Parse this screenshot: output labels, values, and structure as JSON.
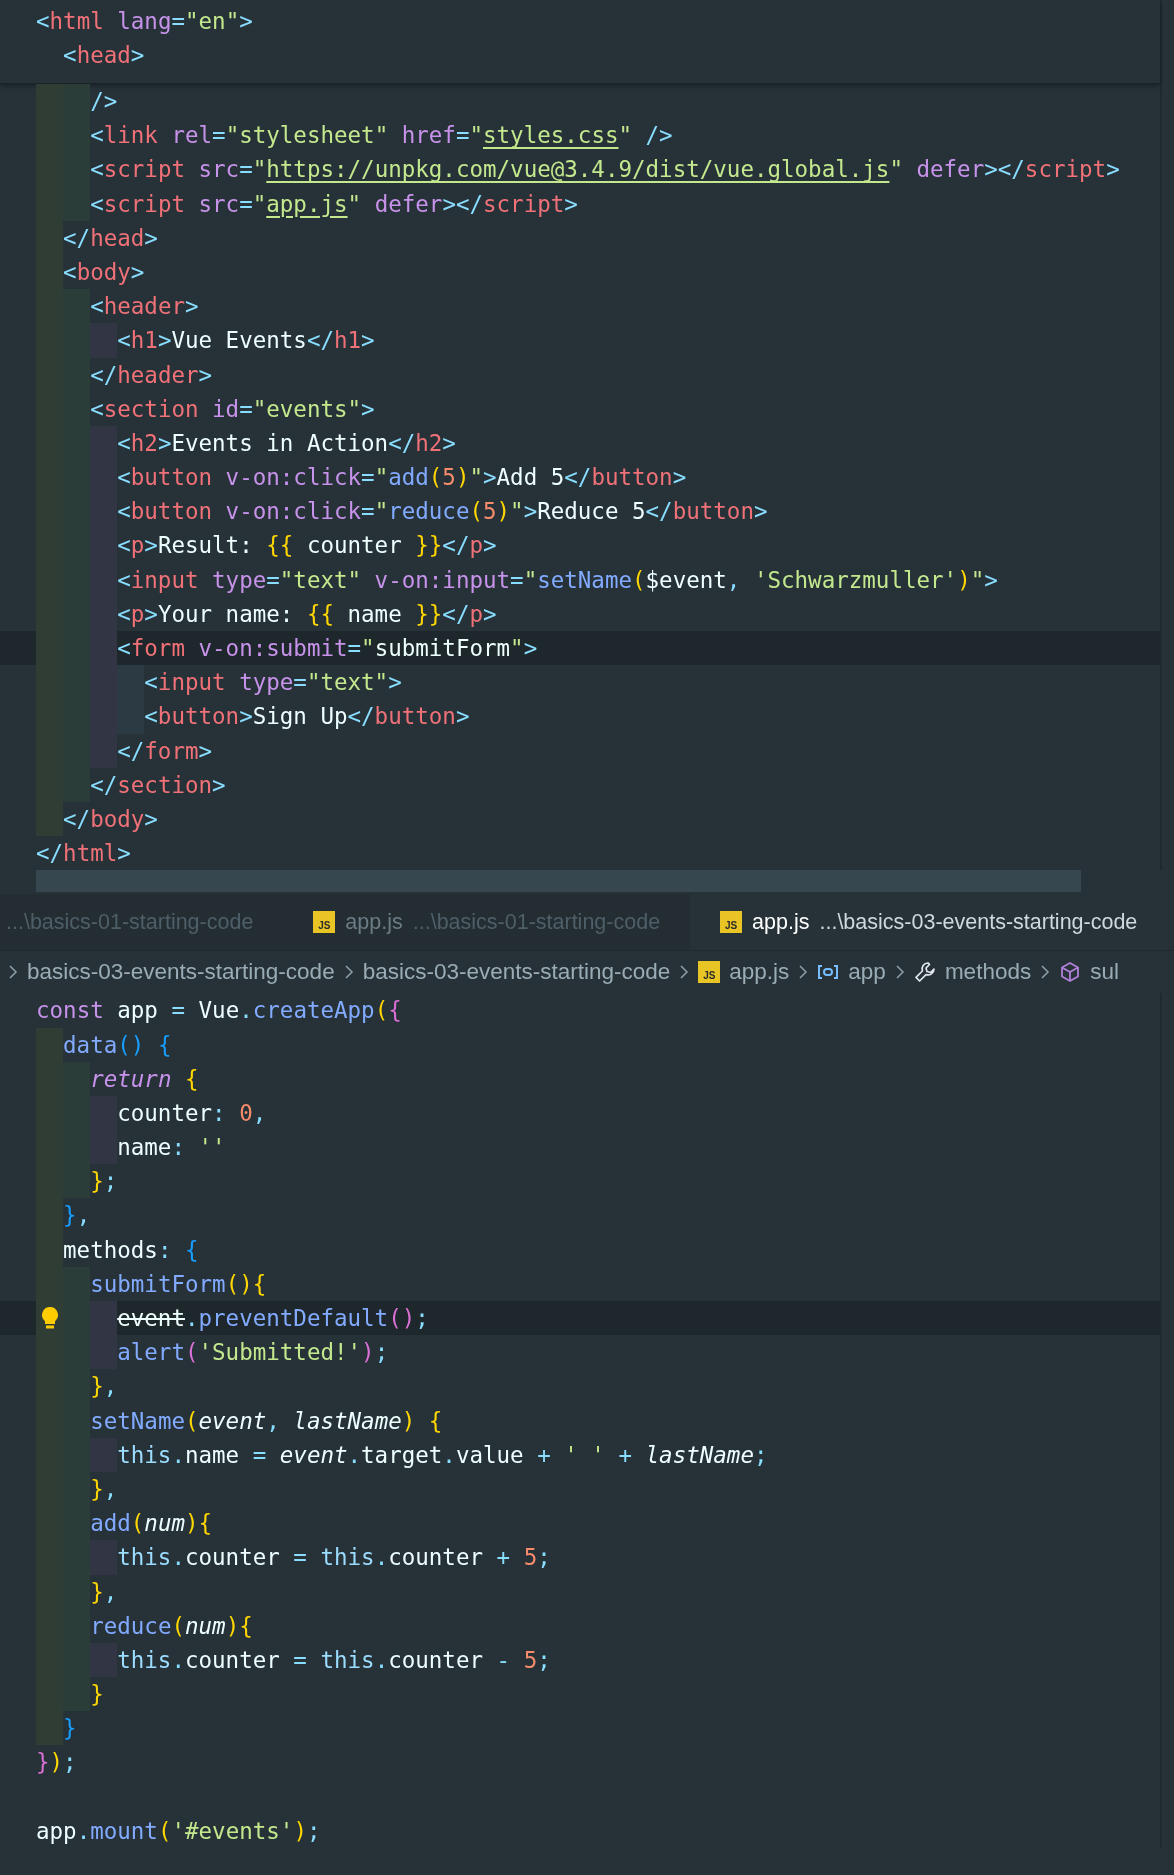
{
  "top_editor": {
    "sticky_lines": [
      {
        "tokens": [
          {
            "text": "<",
            "kind": "punct"
          },
          {
            "text": "html",
            "kind": "tag"
          },
          {
            "text": " lang",
            "kind": "attr"
          },
          {
            "text": "=",
            "kind": "punct"
          },
          {
            "text": "\"en\"",
            "kind": "string"
          },
          {
            "text": ">",
            "kind": "punct"
          }
        ]
      },
      {
        "tokens": [
          {
            "text": "  <",
            "kind": "punct"
          },
          {
            "text": "head",
            "kind": "tag"
          },
          {
            "text": ">",
            "kind": "punct"
          }
        ]
      }
    ],
    "lines": [
      {
        "current": false,
        "lightbulb": false,
        "tokens": [
          {
            "text": "    />",
            "kind": "punct"
          }
        ]
      },
      {
        "current": false,
        "lightbulb": false,
        "tokens": [
          {
            "text": "    <",
            "kind": "punct"
          },
          {
            "text": "link",
            "kind": "tag"
          },
          {
            "text": " rel",
            "kind": "attr"
          },
          {
            "text": "=",
            "kind": "punct"
          },
          {
            "text": "\"stylesheet\"",
            "kind": "string"
          },
          {
            "text": " href",
            "kind": "attr"
          },
          {
            "text": "=",
            "kind": "punct"
          },
          {
            "text": "\"",
            "kind": "string"
          },
          {
            "text": "styles.css",
            "kind": "link"
          },
          {
            "text": "\"",
            "kind": "string"
          },
          {
            "text": " />",
            "kind": "punct"
          }
        ]
      },
      {
        "current": false,
        "lightbulb": false,
        "tokens": [
          {
            "text": "    <",
            "kind": "punct"
          },
          {
            "text": "script",
            "kind": "tag"
          },
          {
            "text": " src",
            "kind": "attr"
          },
          {
            "text": "=",
            "kind": "punct"
          },
          {
            "text": "\"",
            "kind": "string"
          },
          {
            "text": "https://unpkg.com/vue@3.4.9/dist/vue.global.js",
            "kind": "link"
          },
          {
            "text": "\"",
            "kind": "string"
          },
          {
            "text": " defer",
            "kind": "attr"
          },
          {
            "text": "></",
            "kind": "punct"
          },
          {
            "text": "script",
            "kind": "tag"
          },
          {
            "text": ">",
            "kind": "punct"
          }
        ]
      },
      {
        "current": false,
        "lightbulb": false,
        "tokens": [
          {
            "text": "    <",
            "kind": "punct"
          },
          {
            "text": "script",
            "kind": "tag"
          },
          {
            "text": " src",
            "kind": "attr"
          },
          {
            "text": "=",
            "kind": "punct"
          },
          {
            "text": "\"",
            "kind": "string"
          },
          {
            "text": "app.js",
            "kind": "link"
          },
          {
            "text": "\"",
            "kind": "string"
          },
          {
            "text": " defer",
            "kind": "attr"
          },
          {
            "text": "></",
            "kind": "punct"
          },
          {
            "text": "script",
            "kind": "tag"
          },
          {
            "text": ">",
            "kind": "punct"
          }
        ]
      },
      {
        "current": false,
        "lightbulb": false,
        "tokens": [
          {
            "text": "  </",
            "kind": "punct"
          },
          {
            "text": "head",
            "kind": "tag"
          },
          {
            "text": ">",
            "kind": "punct"
          }
        ]
      },
      {
        "current": false,
        "lightbulb": false,
        "tokens": [
          {
            "text": "  <",
            "kind": "punct"
          },
          {
            "text": "body",
            "kind": "tag"
          },
          {
            "text": ">",
            "kind": "punct"
          }
        ]
      },
      {
        "current": false,
        "lightbulb": false,
        "tokens": [
          {
            "text": "    <",
            "kind": "punct"
          },
          {
            "text": "header",
            "kind": "tag"
          },
          {
            "text": ">",
            "kind": "punct"
          }
        ]
      },
      {
        "current": false,
        "lightbulb": false,
        "tokens": [
          {
            "text": "      <",
            "kind": "punct"
          },
          {
            "text": "h1",
            "kind": "tag"
          },
          {
            "text": ">",
            "kind": "punct"
          },
          {
            "text": "Vue Events",
            "kind": "text"
          },
          {
            "text": "</",
            "kind": "punct"
          },
          {
            "text": "h1",
            "kind": "tag"
          },
          {
            "text": ">",
            "kind": "punct"
          }
        ]
      },
      {
        "current": false,
        "lightbulb": false,
        "tokens": [
          {
            "text": "    </",
            "kind": "punct"
          },
          {
            "text": "header",
            "kind": "tag"
          },
          {
            "text": ">",
            "kind": "punct"
          }
        ]
      },
      {
        "current": false,
        "lightbulb": false,
        "tokens": [
          {
            "text": "    <",
            "kind": "punct"
          },
          {
            "text": "section",
            "kind": "tag"
          },
          {
            "text": " id",
            "kind": "attr"
          },
          {
            "text": "=",
            "kind": "punct"
          },
          {
            "text": "\"events\"",
            "kind": "string"
          },
          {
            "text": ">",
            "kind": "punct"
          }
        ]
      },
      {
        "current": false,
        "lightbulb": false,
        "tokens": [
          {
            "text": "      <",
            "kind": "punct"
          },
          {
            "text": "h2",
            "kind": "tag"
          },
          {
            "text": ">",
            "kind": "punct"
          },
          {
            "text": "Events in Action",
            "kind": "text"
          },
          {
            "text": "</",
            "kind": "punct"
          },
          {
            "text": "h2",
            "kind": "tag"
          },
          {
            "text": ">",
            "kind": "punct"
          }
        ]
      },
      {
        "current": false,
        "lightbulb": false,
        "tokens": [
          {
            "text": "      <",
            "kind": "punct"
          },
          {
            "text": "button",
            "kind": "tag"
          },
          {
            "text": " v-on:click",
            "kind": "attr"
          },
          {
            "text": "=",
            "kind": "punct"
          },
          {
            "text": "\"",
            "kind": "string"
          },
          {
            "text": "add",
            "kind": "function"
          },
          {
            "text": "(",
            "kind": "bracket1"
          },
          {
            "text": "5",
            "kind": "number"
          },
          {
            "text": ")",
            "kind": "bracket1"
          },
          {
            "text": "\"",
            "kind": "string"
          },
          {
            "text": ">",
            "kind": "punct"
          },
          {
            "text": "Add 5",
            "kind": "text"
          },
          {
            "text": "</",
            "kind": "punct"
          },
          {
            "text": "button",
            "kind": "tag"
          },
          {
            "text": ">",
            "kind": "punct"
          }
        ]
      },
      {
        "current": false,
        "lightbulb": false,
        "tokens": [
          {
            "text": "      <",
            "kind": "punct"
          },
          {
            "text": "button",
            "kind": "tag"
          },
          {
            "text": " v-on:click",
            "kind": "attr"
          },
          {
            "text": "=",
            "kind": "punct"
          },
          {
            "text": "\"",
            "kind": "string"
          },
          {
            "text": "reduce",
            "kind": "function"
          },
          {
            "text": "(",
            "kind": "bracket1"
          },
          {
            "text": "5",
            "kind": "number"
          },
          {
            "text": ")",
            "kind": "bracket1"
          },
          {
            "text": "\"",
            "kind": "string"
          },
          {
            "text": ">",
            "kind": "punct"
          },
          {
            "text": "Reduce 5",
            "kind": "text"
          },
          {
            "text": "</",
            "kind": "punct"
          },
          {
            "text": "button",
            "kind": "tag"
          },
          {
            "text": ">",
            "kind": "punct"
          }
        ]
      },
      {
        "current": false,
        "lightbulb": false,
        "tokens": [
          {
            "text": "      <",
            "kind": "punct"
          },
          {
            "text": "p",
            "kind": "tag"
          },
          {
            "text": ">",
            "kind": "punct"
          },
          {
            "text": "Result: ",
            "kind": "text"
          },
          {
            "text": "{{",
            "kind": "bracket1"
          },
          {
            "text": " counter ",
            "kind": "text"
          },
          {
            "text": "}}",
            "kind": "bracket1"
          },
          {
            "text": "</",
            "kind": "punct"
          },
          {
            "text": "p",
            "kind": "tag"
          },
          {
            "text": ">",
            "kind": "punct"
          }
        ]
      },
      {
        "current": false,
        "lightbulb": false,
        "tokens": [
          {
            "text": "      <",
            "kind": "punct"
          },
          {
            "text": "input",
            "kind": "tag"
          },
          {
            "text": " type",
            "kind": "attr"
          },
          {
            "text": "=",
            "kind": "punct"
          },
          {
            "text": "\"text\"",
            "kind": "string"
          },
          {
            "text": " v-on:input",
            "kind": "attr"
          },
          {
            "text": "=",
            "kind": "punct"
          },
          {
            "text": "\"",
            "kind": "string"
          },
          {
            "text": "setName",
            "kind": "function"
          },
          {
            "text": "(",
            "kind": "bracket1"
          },
          {
            "text": "$event",
            "kind": "text"
          },
          {
            "text": ", ",
            "kind": "punct"
          },
          {
            "text": "'Schwarzmuller'",
            "kind": "string"
          },
          {
            "text": ")",
            "kind": "bracket1"
          },
          {
            "text": "\"",
            "kind": "string"
          },
          {
            "text": ">",
            "kind": "punct"
          }
        ]
      },
      {
        "current": false,
        "lightbulb": false,
        "tokens": [
          {
            "text": "      <",
            "kind": "punct"
          },
          {
            "text": "p",
            "kind": "tag"
          },
          {
            "text": ">",
            "kind": "punct"
          },
          {
            "text": "Your name: ",
            "kind": "text"
          },
          {
            "text": "{{",
            "kind": "bracket1"
          },
          {
            "text": " name ",
            "kind": "text"
          },
          {
            "text": "}}",
            "kind": "bracket1"
          },
          {
            "text": "</",
            "kind": "punct"
          },
          {
            "text": "p",
            "kind": "tag"
          },
          {
            "text": ">",
            "kind": "punct"
          }
        ]
      },
      {
        "current": true,
        "lightbulb": false,
        "tokens": [
          {
            "text": "      <",
            "kind": "punct"
          },
          {
            "text": "form",
            "kind": "tag"
          },
          {
            "text": " v-on:submit",
            "kind": "attr"
          },
          {
            "text": "=",
            "kind": "punct"
          },
          {
            "text": "\"",
            "kind": "string"
          },
          {
            "text": "submitForm",
            "kind": "text"
          },
          {
            "text": "\"",
            "kind": "string"
          },
          {
            "text": ">",
            "kind": "punct"
          }
        ]
      },
      {
        "current": false,
        "lightbulb": false,
        "tokens": [
          {
            "text": "        <",
            "kind": "punct"
          },
          {
            "text": "input",
            "kind": "tag"
          },
          {
            "text": " type",
            "kind": "attr"
          },
          {
            "text": "=",
            "kind": "punct"
          },
          {
            "text": "\"text\"",
            "kind": "string"
          },
          {
            "text": ">",
            "kind": "punct"
          }
        ]
      },
      {
        "current": false,
        "lightbulb": false,
        "tokens": [
          {
            "text": "        <",
            "kind": "punct"
          },
          {
            "text": "button",
            "kind": "tag"
          },
          {
            "text": ">",
            "kind": "punct"
          },
          {
            "text": "Sign Up",
            "kind": "text"
          },
          {
            "text": "</",
            "kind": "punct"
          },
          {
            "text": "button",
            "kind": "tag"
          },
          {
            "text": ">",
            "kind": "punct"
          }
        ]
      },
      {
        "current": false,
        "lightbulb": false,
        "tokens": [
          {
            "text": "      </",
            "kind": "punct"
          },
          {
            "text": "form",
            "kind": "tag"
          },
          {
            "text": ">",
            "kind": "punct"
          }
        ]
      },
      {
        "current": false,
        "lightbulb": false,
        "tokens": [
          {
            "text": "    </",
            "kind": "punct"
          },
          {
            "text": "section",
            "kind": "tag"
          },
          {
            "text": ">",
            "kind": "punct"
          }
        ]
      },
      {
        "current": false,
        "lightbulb": false,
        "tokens": [
          {
            "text": "  </",
            "kind": "punct"
          },
          {
            "text": "body",
            "kind": "tag"
          },
          {
            "text": ">",
            "kind": "punct"
          }
        ]
      },
      {
        "current": false,
        "lightbulb": false,
        "tokens": [
          {
            "text": "</",
            "kind": "punct"
          },
          {
            "text": "html",
            "kind": "tag"
          },
          {
            "text": ">",
            "kind": "punct"
          }
        ]
      }
    ]
  },
  "tabs": [
    {
      "description": "...\\basics-01-starting-code",
      "selected": false
    },
    {
      "icon": "JS",
      "name": "app.js",
      "description": "...\\basics-01-starting-code",
      "selected": false
    },
    {
      "icon": "JS",
      "name": "app.js",
      "description": "...\\basics-03-events-starting-code",
      "selected": true
    }
  ],
  "breadcrumbs": [
    {
      "kind": "folder",
      "label": "basics-03-events-starting-code"
    },
    {
      "kind": "folder",
      "label": "basics-03-events-starting-code"
    },
    {
      "kind": "file",
      "icon": "JS",
      "label": "app.js"
    },
    {
      "kind": "variable",
      "label": "app"
    },
    {
      "kind": "method",
      "label": "methods"
    },
    {
      "kind": "property",
      "label": "sul"
    }
  ],
  "bottom_editor": {
    "lines": [
      {
        "current": false,
        "lightbulb": false,
        "tokens": [
          {
            "text": "const",
            "kind": "keyword"
          },
          {
            "text": " app ",
            "kind": "text"
          },
          {
            "text": "=",
            "kind": "punct"
          },
          {
            "text": " Vue",
            "kind": "text"
          },
          {
            "text": ".",
            "kind": "punct"
          },
          {
            "text": "createApp",
            "kind": "function"
          },
          {
            "text": "(",
            "kind": "bracket1"
          },
          {
            "text": "{",
            "kind": "bracket2"
          }
        ]
      },
      {
        "current": false,
        "lightbulb": false,
        "tokens": [
          {
            "text": "  data",
            "kind": "function"
          },
          {
            "text": "()",
            "kind": "bracket3"
          },
          {
            "text": " {",
            "kind": "bracket3"
          }
        ]
      },
      {
        "current": false,
        "lightbulb": false,
        "tokens": [
          {
            "text": "    return",
            "kind": "keyword_italic"
          },
          {
            "text": " {",
            "kind": "bracket1"
          }
        ]
      },
      {
        "current": false,
        "lightbulb": false,
        "tokens": [
          {
            "text": "      counter",
            "kind": "text"
          },
          {
            "text": ":",
            "kind": "punct"
          },
          {
            "text": " 0",
            "kind": "number"
          },
          {
            "text": ",",
            "kind": "punct"
          }
        ]
      },
      {
        "current": false,
        "lightbulb": false,
        "tokens": [
          {
            "text": "      name",
            "kind": "text"
          },
          {
            "text": ":",
            "kind": "punct"
          },
          {
            "text": " ''",
            "kind": "string"
          }
        ]
      },
      {
        "current": false,
        "lightbulb": false,
        "tokens": [
          {
            "text": "    }",
            "kind": "bracket1"
          },
          {
            "text": ";",
            "kind": "punct"
          }
        ]
      },
      {
        "current": false,
        "lightbulb": false,
        "tokens": [
          {
            "text": "  }",
            "kind": "bracket3"
          },
          {
            "text": ",",
            "kind": "punct"
          }
        ]
      },
      {
        "current": false,
        "lightbulb": false,
        "tokens": [
          {
            "text": "  methods",
            "kind": "text"
          },
          {
            "text": ":",
            "kind": "punct"
          },
          {
            "text": " {",
            "kind": "bracket3"
          }
        ]
      },
      {
        "current": false,
        "lightbulb": false,
        "tokens": [
          {
            "text": "    submitForm",
            "kind": "function"
          },
          {
            "text": "(){",
            "kind": "bracket1"
          }
        ]
      },
      {
        "current": true,
        "lightbulb": true,
        "tokens": [
          {
            "text": "      event",
            "kind": "deprecated"
          },
          {
            "text": ".",
            "kind": "punct"
          },
          {
            "text": "preventDefault",
            "kind": "function"
          },
          {
            "text": "()",
            "kind": "bracket2"
          },
          {
            "text": ";",
            "kind": "punct"
          }
        ]
      },
      {
        "current": false,
        "lightbulb": false,
        "tokens": [
          {
            "text": "      alert",
            "kind": "function"
          },
          {
            "text": "(",
            "kind": "bracket2"
          },
          {
            "text": "'Submitted!'",
            "kind": "string"
          },
          {
            "text": ")",
            "kind": "bracket2"
          },
          {
            "text": ";",
            "kind": "punct"
          }
        ]
      },
      {
        "current": false,
        "lightbulb": false,
        "tokens": [
          {
            "text": "    }",
            "kind": "bracket1"
          },
          {
            "text": ",",
            "kind": "punct"
          }
        ]
      },
      {
        "current": false,
        "lightbulb": false,
        "tokens": [
          {
            "text": "    setName",
            "kind": "function"
          },
          {
            "text": "(",
            "kind": "bracket1"
          },
          {
            "text": "event",
            "kind": "param"
          },
          {
            "text": ", ",
            "kind": "punct"
          },
          {
            "text": "lastName",
            "kind": "param"
          },
          {
            "text": ")",
            "kind": "bracket1"
          },
          {
            "text": " {",
            "kind": "bracket1"
          }
        ]
      },
      {
        "current": false,
        "lightbulb": false,
        "tokens": [
          {
            "text": "      this",
            "kind": "this"
          },
          {
            "text": ".",
            "kind": "punct"
          },
          {
            "text": "name ",
            "kind": "text"
          },
          {
            "text": "=",
            "kind": "punct"
          },
          {
            "text": " event",
            "kind": "param"
          },
          {
            "text": ".",
            "kind": "punct"
          },
          {
            "text": "target",
            "kind": "text"
          },
          {
            "text": ".",
            "kind": "punct"
          },
          {
            "text": "value ",
            "kind": "text"
          },
          {
            "text": "+",
            "kind": "punct"
          },
          {
            "text": " ' ' ",
            "kind": "string"
          },
          {
            "text": "+",
            "kind": "punct"
          },
          {
            "text": " lastName",
            "kind": "param"
          },
          {
            "text": ";",
            "kind": "punct"
          }
        ]
      },
      {
        "current": false,
        "lightbulb": false,
        "tokens": [
          {
            "text": "    }",
            "kind": "bracket1"
          },
          {
            "text": ",",
            "kind": "punct"
          }
        ]
      },
      {
        "current": false,
        "lightbulb": false,
        "tokens": [
          {
            "text": "    add",
            "kind": "function"
          },
          {
            "text": "(",
            "kind": "bracket1"
          },
          {
            "text": "num",
            "kind": "param"
          },
          {
            "text": ")",
            "kind": "bracket1"
          },
          {
            "text": "{",
            "kind": "bracket1"
          }
        ]
      },
      {
        "current": false,
        "lightbulb": false,
        "tokens": [
          {
            "text": "      this",
            "kind": "this"
          },
          {
            "text": ".",
            "kind": "punct"
          },
          {
            "text": "counter ",
            "kind": "text"
          },
          {
            "text": "=",
            "kind": "punct"
          },
          {
            "text": " this",
            "kind": "this"
          },
          {
            "text": ".",
            "kind": "punct"
          },
          {
            "text": "counter ",
            "kind": "text"
          },
          {
            "text": "+",
            "kind": "punct"
          },
          {
            "text": " 5",
            "kind": "number"
          },
          {
            "text": ";",
            "kind": "punct"
          }
        ]
      },
      {
        "current": false,
        "lightbulb": false,
        "tokens": [
          {
            "text": "    }",
            "kind": "bracket1"
          },
          {
            "text": ",",
            "kind": "punct"
          }
        ]
      },
      {
        "current": false,
        "lightbulb": false,
        "tokens": [
          {
            "text": "    reduce",
            "kind": "function"
          },
          {
            "text": "(",
            "kind": "bracket1"
          },
          {
            "text": "num",
            "kind": "param"
          },
          {
            "text": ")",
            "kind": "bracket1"
          },
          {
            "text": "{",
            "kind": "bracket1"
          }
        ]
      },
      {
        "current": false,
        "lightbulb": false,
        "tokens": [
          {
            "text": "      this",
            "kind": "this"
          },
          {
            "text": ".",
            "kind": "punct"
          },
          {
            "text": "counter ",
            "kind": "text"
          },
          {
            "text": "=",
            "kind": "punct"
          },
          {
            "text": " this",
            "kind": "this"
          },
          {
            "text": ".",
            "kind": "punct"
          },
          {
            "text": "counter ",
            "kind": "text"
          },
          {
            "text": "-",
            "kind": "punct"
          },
          {
            "text": " 5",
            "kind": "number"
          },
          {
            "text": ";",
            "kind": "punct"
          }
        ]
      },
      {
        "current": false,
        "lightbulb": false,
        "tokens": [
          {
            "text": "    }",
            "kind": "bracket1"
          }
        ]
      },
      {
        "current": false,
        "lightbulb": false,
        "tokens": [
          {
            "text": "  }",
            "kind": "bracket3"
          }
        ]
      },
      {
        "current": false,
        "lightbulb": false,
        "tokens": [
          {
            "text": "}",
            "kind": "bracket2"
          },
          {
            "text": ")",
            "kind": "bracket1"
          },
          {
            "text": ";",
            "kind": "punct"
          }
        ]
      }
    ],
    "trailing_lines": [
      {
        "current": false,
        "lightbulb": false,
        "tokens": [
          {
            "text": "app",
            "kind": "text"
          },
          {
            "text": ".",
            "kind": "punct"
          },
          {
            "text": "mount",
            "kind": "function"
          },
          {
            "text": "(",
            "kind": "bracket1"
          },
          {
            "text": "'#events'",
            "kind": "string"
          },
          {
            "text": ")",
            "kind": "bracket1"
          },
          {
            "text": ";",
            "kind": "punct"
          }
        ]
      }
    ]
  }
}
